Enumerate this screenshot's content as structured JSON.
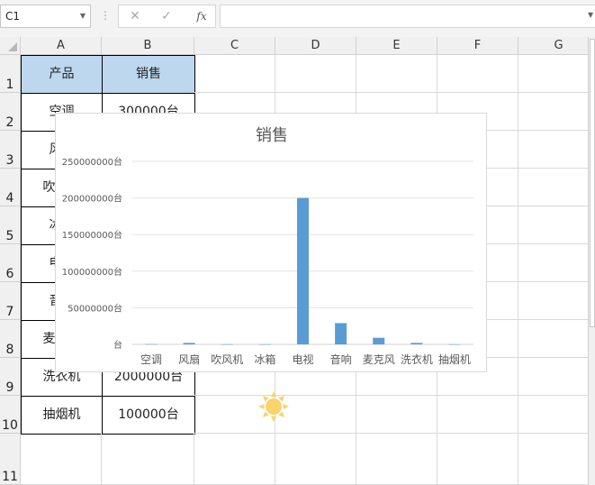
{
  "namebox": {
    "value": "C1"
  },
  "formula": {
    "fx_label": "fx",
    "value": ""
  },
  "columns": [
    "A",
    "B",
    "C",
    "D",
    "E",
    "F",
    "G"
  ],
  "rows": [
    "1",
    "2",
    "3",
    "4",
    "5",
    "6",
    "7",
    "8",
    "9",
    "10",
    "11"
  ],
  "table": {
    "headers": [
      "产品",
      "销售"
    ],
    "rows": [
      [
        "空调",
        "300000台"
      ],
      [
        "风扇",
        ""
      ],
      [
        "吹风机",
        ""
      ],
      [
        "冰箱",
        ""
      ],
      [
        "电视",
        ""
      ],
      [
        "音响",
        ""
      ],
      [
        "麦克风",
        ""
      ],
      [
        "洗衣机",
        "2000000台"
      ],
      [
        "抽烟机",
        "100000台"
      ]
    ]
  },
  "colors": {
    "bar": "#5b9bd5",
    "header_fill": "#bdd7ee",
    "sun": "#f9d36b"
  },
  "icons": [
    "cancel-icon",
    "enter-icon",
    "function-icon",
    "sun-icon"
  ],
  "chart_data": {
    "type": "bar",
    "title": "销售",
    "categories": [
      "空调",
      "风扇",
      "吹风机",
      "冰箱",
      "电视",
      "音响",
      "麦克风",
      "洗衣机",
      "抽烟机"
    ],
    "values": [
      300000,
      2000000,
      100000,
      100000,
      200000000,
      29000000,
      9000000,
      2000000,
      100000
    ],
    "ylim": [
      0,
      250000000
    ],
    "yticks": [
      0,
      50000000,
      100000000,
      150000000,
      200000000,
      250000000
    ],
    "ytick_labels": [
      "台",
      "50000000台",
      "100000000台",
      "150000000台",
      "200000000台",
      "250000000台"
    ],
    "grid": true,
    "xlabel": "",
    "ylabel": ""
  }
}
